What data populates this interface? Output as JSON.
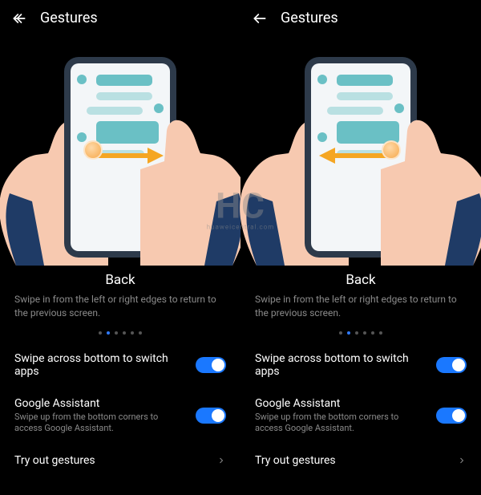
{
  "watermark": {
    "big": "HC",
    "small": "huaweicentral.com"
  },
  "panels": [
    {
      "header": {
        "title": "Gestures"
      },
      "gesture": {
        "title": "Back",
        "desc": "Swipe in from the left or right edges to return to the previous screen.",
        "direction": "right",
        "active_dot": 1,
        "total_dots": 6
      },
      "settings": {
        "switch_apps": {
          "label": "Swipe across bottom to switch apps",
          "on": true
        },
        "assistant": {
          "label": "Google Assistant",
          "sub": "Swipe up from the bottom corners to access Google Assistant.",
          "on": true
        },
        "try_out": {
          "label": "Try out gestures"
        }
      }
    },
    {
      "header": {
        "title": "Gestures"
      },
      "gesture": {
        "title": "Back",
        "desc": "Swipe in from the left or right edges to return to the previous screen.",
        "direction": "left",
        "active_dot": 1,
        "total_dots": 6
      },
      "settings": {
        "switch_apps": {
          "label": "Swipe across bottom to switch apps",
          "on": true
        },
        "assistant": {
          "label": "Google Assistant",
          "sub": "Swipe up from the bottom corners to access Google Assistant.",
          "on": true
        },
        "try_out": {
          "label": "Try out gestures"
        }
      }
    }
  ]
}
